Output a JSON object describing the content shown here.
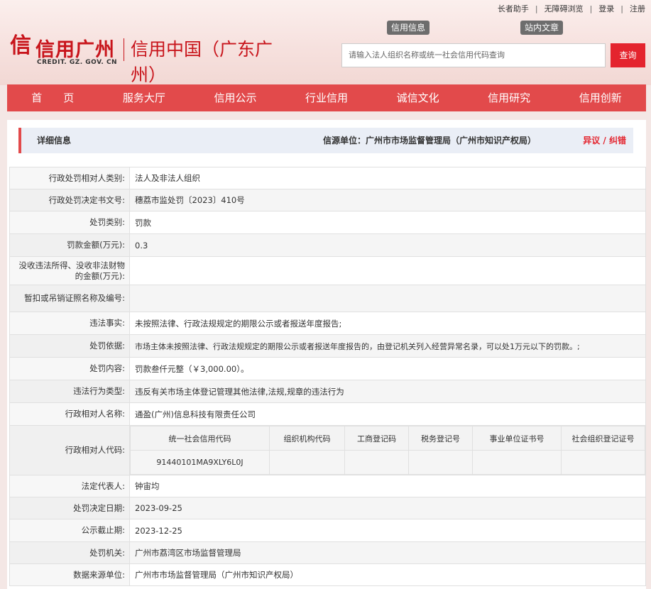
{
  "top_links": [
    "长者助手",
    "无障碍浏览",
    "登录",
    "注册"
  ],
  "logo": {
    "mark": "信",
    "name": "信用广州",
    "name2": "信用中国（广东广州）",
    "sub": "CREDIT. GZ. GOV. CN"
  },
  "search": {
    "tabs": [
      "信用信息",
      "站内文章"
    ],
    "placeholder": "请输入法人组织名称或统一社会信用代码查询",
    "button": "查询"
  },
  "nav": [
    "首　　页",
    "服务大厅",
    "信用公示",
    "行业信用",
    "诚信文化",
    "信用研究",
    "信用创新"
  ],
  "detail": {
    "title": "详细信息",
    "source": "信源单位：广州市市场监督管理局（广州市知识产权局）",
    "objection": "异议 / 纠错"
  },
  "fields": [
    {
      "key": "行政处罚相对人类别:",
      "value": "法人及非法人组织"
    },
    {
      "key": "行政处罚决定书文号:",
      "value": "穗荔市监处罚〔2023〕410号"
    },
    {
      "key": "处罚类别:",
      "value": "罚款"
    },
    {
      "key": "罚款金额(万元):",
      "value": "0.3"
    },
    {
      "key": "没收违法所得、没收非法财物的金额(万元):",
      "value": ""
    },
    {
      "key": "暂扣或吊销证照名称及编号:",
      "value": ""
    },
    {
      "key": "违法事实:",
      "value": "未按照法律、行政法规规定的期限公示或者报送年度报告;"
    },
    {
      "key": "处罚依据:",
      "value": "市场主体未按照法律、行政法规规定的期限公示或者报送年度报告的，由登记机关列入经营异常名录，可以处1万元以下的罚款。;"
    },
    {
      "key": "处罚内容:",
      "value": "罚款叁仟元整（￥3,000.00）。"
    },
    {
      "key": "违法行为类型:",
      "value": "违反有关市场主体登记管理其他法律,法规,规章的违法行为"
    },
    {
      "key": "行政相对人名称:",
      "value": "通盈(广州)信息科技有限责任公司"
    }
  ],
  "code_row": {
    "key": "行政相对人代码:",
    "headers": [
      "统一社会信用代码",
      "组织机构代码",
      "工商登记码",
      "税务登记号",
      "事业单位证书号",
      "社会组织登记证号"
    ],
    "values": [
      "91440101MA9XLY6L0J",
      "",
      "",
      "",
      "",
      ""
    ]
  },
  "fields_after": [
    {
      "key": "法定代表人:",
      "value": "钟宙均"
    },
    {
      "key": "处罚决定日期:",
      "value": "2023-09-25"
    },
    {
      "key": "公示截止期:",
      "value": "2023-12-25"
    },
    {
      "key": "处罚机关:",
      "value": "广州市荔湾区市场监督管理局"
    },
    {
      "key": "数据来源单位:",
      "value": "广州市市场监督管理局（广州市知识产权局）"
    }
  ],
  "colors": {
    "brand_red": "#c8141b",
    "nav_red": "#e24a4b",
    "button_red": "#e4242e"
  }
}
